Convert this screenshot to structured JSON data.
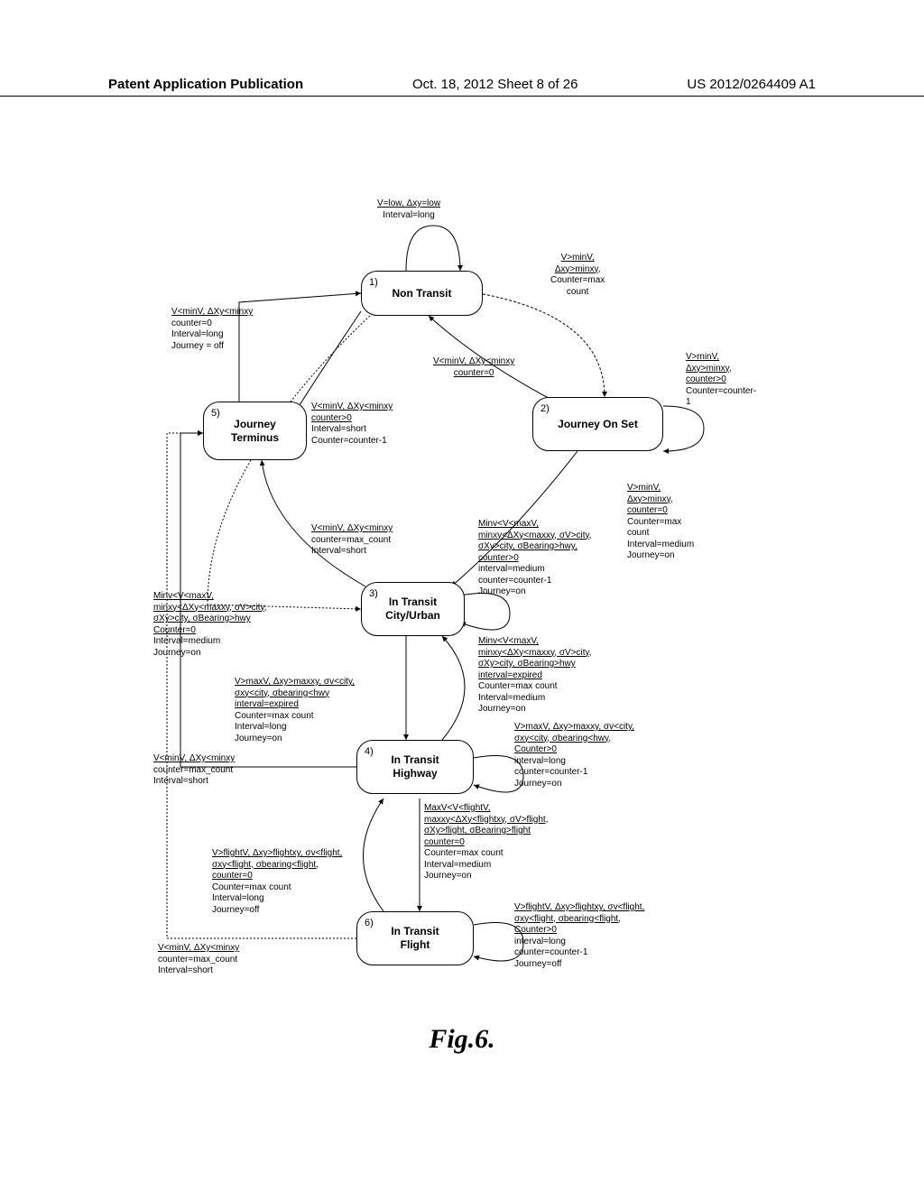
{
  "header": {
    "left": "Patent Application Publication",
    "mid": "Oct. 18, 2012  Sheet 8 of 26",
    "right": "US 2012/0264409 A1"
  },
  "states": {
    "s1": {
      "num": "1)",
      "title": "Non Transit"
    },
    "s2": {
      "num": "2)",
      "title": "Journey On Set"
    },
    "s3": {
      "num": "3)",
      "title1": "In Transit",
      "title2": "City/Urban"
    },
    "s4": {
      "num": "4)",
      "title1": "In Transit",
      "title2": "Highway"
    },
    "s5": {
      "num": "5)",
      "title1": "Journey",
      "title2": "Terminus"
    },
    "s6": {
      "num": "6)",
      "title1": "In Transit",
      "title2": "Flight"
    }
  },
  "conds": {
    "c_top": {
      "u": [
        "V=low, Δxy=low"
      ],
      "p": [
        "Interval=long"
      ]
    },
    "c_top_right": {
      "u": [
        "V>minV,",
        "Δxy>minxy,"
      ],
      "p": [
        "Counter=max",
        "count"
      ]
    },
    "c_top_left": {
      "u": [
        "V<minV, ΔXy<minxy"
      ],
      "p": [
        "counter=0",
        "Interval=long",
        "Journey = off"
      ]
    },
    "c_12_mid": {
      "u": [
        "V<minV, ΔXy<minxy",
        "counter=0"
      ],
      "p": []
    },
    "c_2_right": {
      "u": [
        "V>minV,",
        "Δxy>minxy,",
        "counter>0"
      ],
      "p": [
        "Counter=counter-",
        "1"
      ]
    },
    "c_51": {
      "u": [
        "V<minV, ΔXy<minxy",
        "counter>0"
      ],
      "p": [
        "Interval=short",
        "Counter=counter-1"
      ]
    },
    "c_23": {
      "u": [
        "V>minV,",
        "Δxy>minxy,",
        "counter=0"
      ],
      "p": [
        "Counter=max",
        "count",
        "Interval=medium",
        "Journey=on"
      ]
    },
    "c_35": {
      "u": [
        "V<minV, ΔXy<minxy"
      ],
      "p": [
        "counter=max_count",
        "Interval=short"
      ]
    },
    "c_3_self": {
      "u": [
        "Minv<V<maxV,",
        "minxy<ΔXy<maxxy, σV>city,",
        "σXy>city, σBearing>hwy,",
        "counter>0"
      ],
      "p": [
        "interval=medium",
        "counter=counter-1",
        "Journey=on"
      ]
    },
    "c_13": {
      "u": [
        "Minv<V<maxV,",
        "minxy<ΔXy<maxxy, σV>city,",
        "σXy>city, σBearing>hwy",
        "Counter=0"
      ],
      "p": [
        "Interval=medium",
        "Journey=on"
      ]
    },
    "c_43": {
      "u": [
        "Minv<V<maxV,",
        "minxy<ΔXy<maxxy, σV>city,",
        "σXy>city, σBearing>hwy",
        "interval=expired"
      ],
      "p": [
        "Counter=max count",
        "Interval=medium",
        "Journey=on"
      ]
    },
    "c_34": {
      "u": [
        "V>maxV, Δxy>maxxy, σv<city,",
        "σxy<city, σbearing<hwy",
        "interval=expired"
      ],
      "p": [
        "Counter=max count",
        "Interval=long",
        "Journey=on"
      ]
    },
    "c_4_self": {
      "u": [
        "V>maxV, Δxy>maxxy, σv<city,",
        "σxy<city, σbearing<hwy,",
        "Counter>0"
      ],
      "p": [
        "interval=long",
        "counter=counter-1",
        "Journey=on"
      ]
    },
    "c_45_left": {
      "u": [
        "V<minV, ΔXy<minxy"
      ],
      "p": [
        "counter=max_count",
        "Interval=short"
      ]
    },
    "c_46": {
      "u": [
        "MaxV<V<flightV,",
        "maxxy<ΔXy<flightxy, σV>flight,",
        "σXy>flight, σBearing>flight",
        "counter=0"
      ],
      "p": [
        "Counter=max count",
        "Interval=medium",
        "Journey=on"
      ]
    },
    "c_64": {
      "u": [
        "V>flightV, Δxy>flightxy, σv<flight,",
        "σxy<flight, σbearing<flight,",
        "counter=0"
      ],
      "p": [
        "Counter=max count",
        "Interval=long",
        "Journey=off"
      ]
    },
    "c_6_self": {
      "u": [
        "V>flightV, Δxy>flightxy, σv<flight,",
        "σxy<flight, σbearing<flight,",
        "Counter>0"
      ],
      "p": [
        "interval=long",
        "counter=counter-1",
        "Journey=off"
      ]
    },
    "c_65_left": {
      "u": [
        "V<minV, ΔXy<minxy"
      ],
      "p": [
        "counter=max_count",
        "Interval=short"
      ]
    }
  },
  "caption": "Fig.6."
}
